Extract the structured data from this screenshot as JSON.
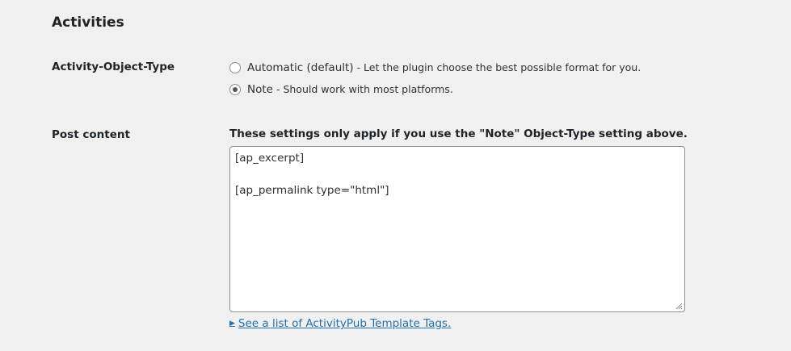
{
  "section": {
    "title": "Activities"
  },
  "object_type": {
    "label": "Activity-Object-Type",
    "options": [
      {
        "label": "Automatic (default)",
        "description": "- Let the plugin choose the best possible format for you.",
        "checked": false
      },
      {
        "label": "Note",
        "description": "- Should work with most platforms.",
        "checked": true
      }
    ]
  },
  "post_content": {
    "label": "Post content",
    "help": "These settings only apply if you use the \"Note\" Object-Type setting above.",
    "value": "[ap_excerpt]\n\n[ap_permalink type=\"html\"]",
    "tags_link": "See a list of ActivityPub Template Tags."
  },
  "colors": {
    "background": "#f0f0f1",
    "link": "#2271b1",
    "border": "#8c8f94"
  }
}
